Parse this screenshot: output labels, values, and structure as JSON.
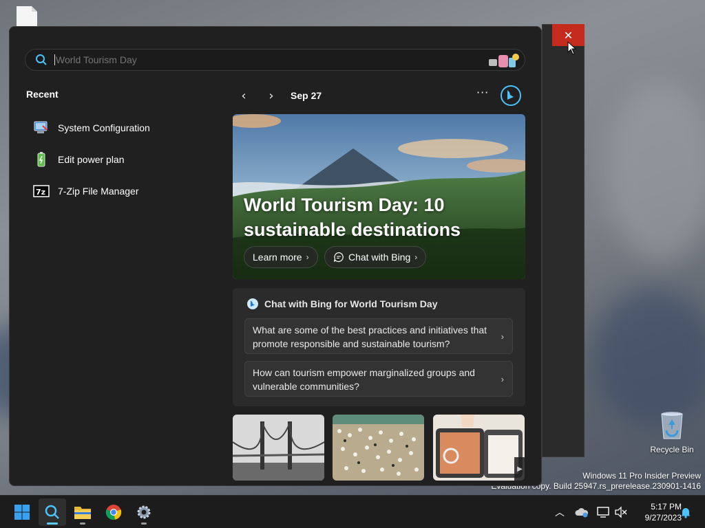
{
  "search": {
    "placeholder": "World Tourism Day"
  },
  "recent": {
    "heading": "Recent",
    "items": [
      {
        "label": "System Configuration",
        "icon": "system-configuration-icon"
      },
      {
        "label": "Edit power plan",
        "icon": "power-plan-icon"
      },
      {
        "label": "7-Zip File Manager",
        "icon": "7zip-icon"
      }
    ]
  },
  "nav": {
    "date": "Sep 27",
    "more": "···"
  },
  "hero": {
    "title": "World Tourism Day: 10 sustainable destinations",
    "learn_more": "Learn more",
    "chat_with_bing": "Chat with Bing"
  },
  "chat": {
    "heading": "Chat with Bing for World Tourism Day",
    "questions": [
      "What are some of the best practices and initiatives that promote responsible and sustainable tourism?",
      "How can tourism empower marginalized groups and vulnerable communities?"
    ]
  },
  "desktop": {
    "recycle_bin": "Recycle Bin",
    "watermark_line1": "Windows 11 Pro Insider Preview",
    "watermark_line2": "Evaluation copy. Build 25947.rs_prerelease.230901-1416"
  },
  "taskbar": {
    "time": "5:17 PM",
    "date": "9/27/2023"
  },
  "colors": {
    "accent": "#60cdff",
    "close_red": "#c42b1c",
    "panel_bg": "#202020"
  }
}
